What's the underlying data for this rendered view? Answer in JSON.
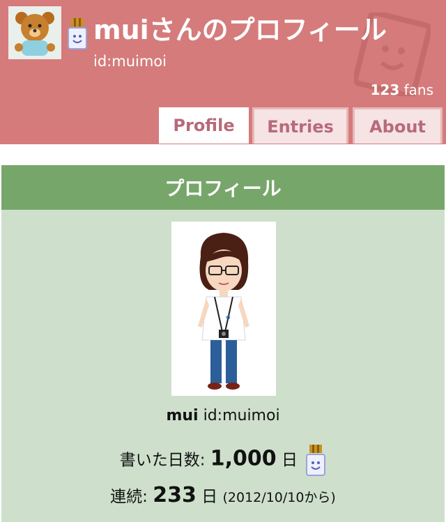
{
  "header": {
    "title": "muiさんのプロフィール",
    "user_id": "id:muimoi",
    "fans_count": "123",
    "fans_label": "fans",
    "avatar_icon": "teddy-bear-avatar",
    "badge_icon": "crown-badge-icon"
  },
  "tabs": [
    {
      "label": "Profile",
      "active": true
    },
    {
      "label": "Entries",
      "active": false
    },
    {
      "label": "About",
      "active": false
    }
  ],
  "profile": {
    "heading": "プロフィール",
    "photo_icon": "character-illustration",
    "name": "mui",
    "user_id": "id:muimoi",
    "days_label": "書いた日数:",
    "days_value": "1,000",
    "days_unit": "日",
    "streak_label": "連続:",
    "streak_value": "233",
    "streak_unit": "日",
    "streak_since": "(2012/10/10から)"
  },
  "colors": {
    "header_bg": "#d57b7b",
    "tab_text": "#b76a7a",
    "section_head": "#77a66a",
    "section_bg": "#cee0cc"
  }
}
